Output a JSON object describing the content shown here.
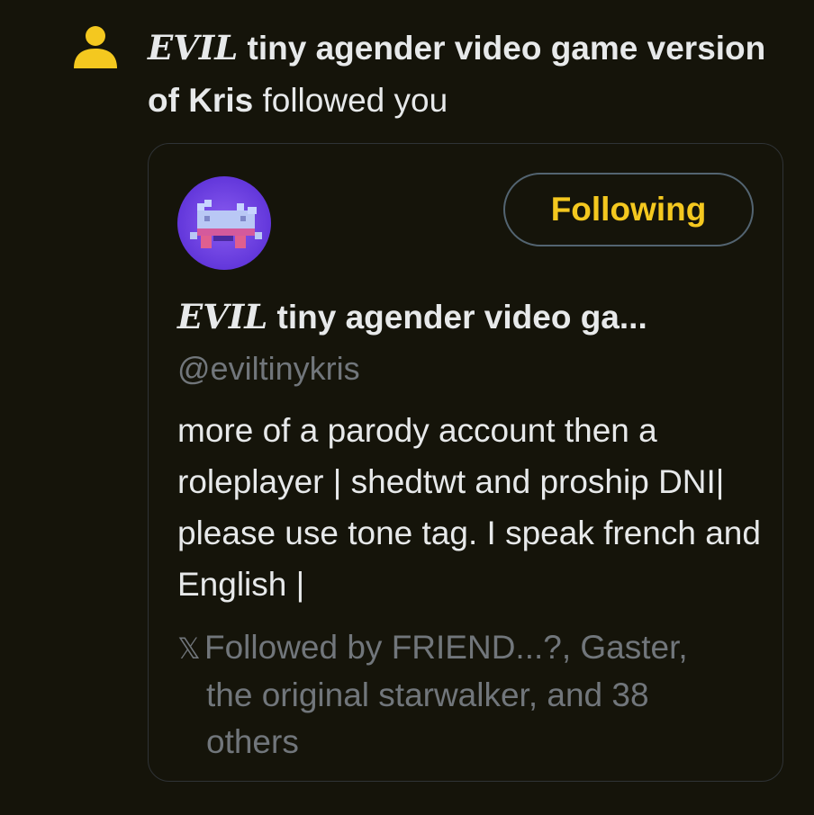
{
  "notification": {
    "icon": "person-icon",
    "icon_color": "#f4c81f",
    "name_evil": "EVIL",
    "name_rest": " tiny agender video game version of Kris",
    "action": " followed you"
  },
  "card": {
    "follow_button_label": "Following",
    "follow_button_color": "#f4c81f",
    "display_name_evil": "EVIL",
    "display_name_rest": " tiny agender video ga...",
    "handle": "@eviltinykris",
    "bio": "more of a parody account then a roleplayer | shedtwt and proship DNI| please use tone tag. I speak french and English |",
    "followed_by_icon": "x-logo-icon",
    "followed_by_line1": "Followed by FRIEND...?, Gaster,",
    "followed_by_line2": "the original starwalker, and 38",
    "followed_by_line3": "others"
  }
}
